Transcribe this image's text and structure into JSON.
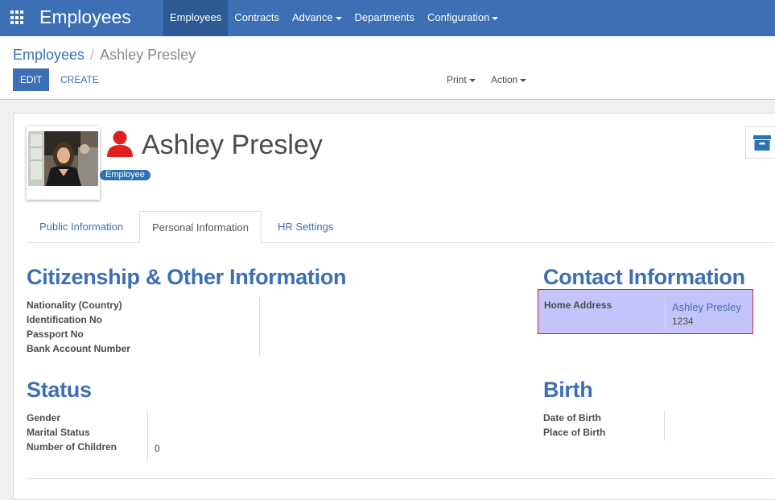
{
  "navbar": {
    "brand": "Employees",
    "menu": [
      {
        "label": "Employees",
        "active": true,
        "dropdown": false
      },
      {
        "label": "Contracts",
        "active": false,
        "dropdown": false
      },
      {
        "label": "Advance",
        "active": false,
        "dropdown": true
      },
      {
        "label": "Departments",
        "active": false,
        "dropdown": false
      },
      {
        "label": "Configuration",
        "active": false,
        "dropdown": true
      }
    ]
  },
  "breadcrumb": {
    "parent": "Employees",
    "separator": "/",
    "current": "Ashley Presley"
  },
  "buttons": {
    "edit": "EDIT",
    "create": "CREATE",
    "print": "Print",
    "action": "Action"
  },
  "employee": {
    "name": "Ashley Presley",
    "tag": "Employee"
  },
  "tabs": [
    {
      "label": "Public Information",
      "active": false
    },
    {
      "label": "Personal Information",
      "active": true
    },
    {
      "label": "HR Settings",
      "active": false
    }
  ],
  "citizenship": {
    "title": "Citizenship & Other Information",
    "fields": [
      {
        "label": "Nationality (Country)",
        "value": ""
      },
      {
        "label": "Identification No",
        "value": ""
      },
      {
        "label": "Passport No",
        "value": ""
      },
      {
        "label": "Bank Account Number",
        "value": ""
      }
    ]
  },
  "contact": {
    "title": "Contact Information",
    "home_address_label": "Home Address",
    "home_address_name": "Ashley Presley",
    "home_address_line": "1234"
  },
  "status": {
    "title": "Status",
    "fields": [
      {
        "label": "Gender",
        "value": ""
      },
      {
        "label": "Marital Status",
        "value": ""
      },
      {
        "label": "Number of Children",
        "value": "0"
      }
    ]
  },
  "birth": {
    "title": "Birth",
    "fields": [
      {
        "label": "Date of Birth",
        "value": ""
      },
      {
        "label": "Place of Birth",
        "value": ""
      }
    ]
  },
  "colors": {
    "primary": "#3c6fb4",
    "nav_active": "#2d5a94",
    "user_icon": "#e02020",
    "tag": "#2a73b5",
    "highlight_fill": "#c4c4fb",
    "highlight_border": "#d4202a"
  },
  "icons": [
    "apps-grid-icon",
    "user-icon",
    "archive-icon",
    "caret-down-icon"
  ]
}
